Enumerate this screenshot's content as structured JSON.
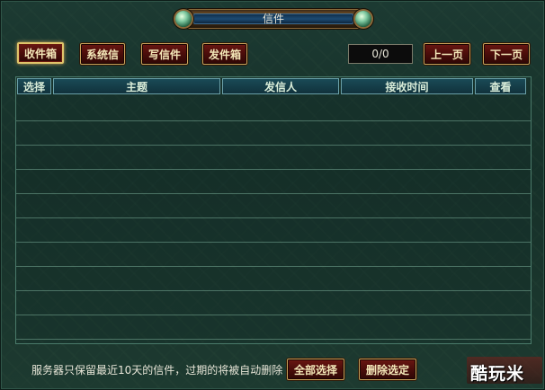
{
  "window": {
    "title": "信件"
  },
  "tabs": [
    {
      "label": "收件箱",
      "active": true
    },
    {
      "label": "系统信",
      "active": false
    },
    {
      "label": "写信件",
      "active": false
    },
    {
      "label": "发件箱",
      "active": false
    }
  ],
  "pagination": {
    "current": "0/0",
    "prev_label": "上一页",
    "next_label": "下一页"
  },
  "table": {
    "columns": [
      "选择",
      "主题",
      "发信人",
      "接收时间",
      "查看"
    ],
    "rows": [
      [],
      [],
      [],
      [],
      [],
      [],
      [],
      [],
      [],
      []
    ]
  },
  "footer": {
    "notice": "服务器只保留最近10天的信件，过期的将被自动删除",
    "select_all_label": "全部选择",
    "delete_selected_label": "删除选定"
  },
  "watermark": {
    "text": "酷玩米"
  },
  "colors": {
    "button_red": "#4a0d0a",
    "button_border": "#c9a25a",
    "header_teal": "#1a4a56"
  }
}
